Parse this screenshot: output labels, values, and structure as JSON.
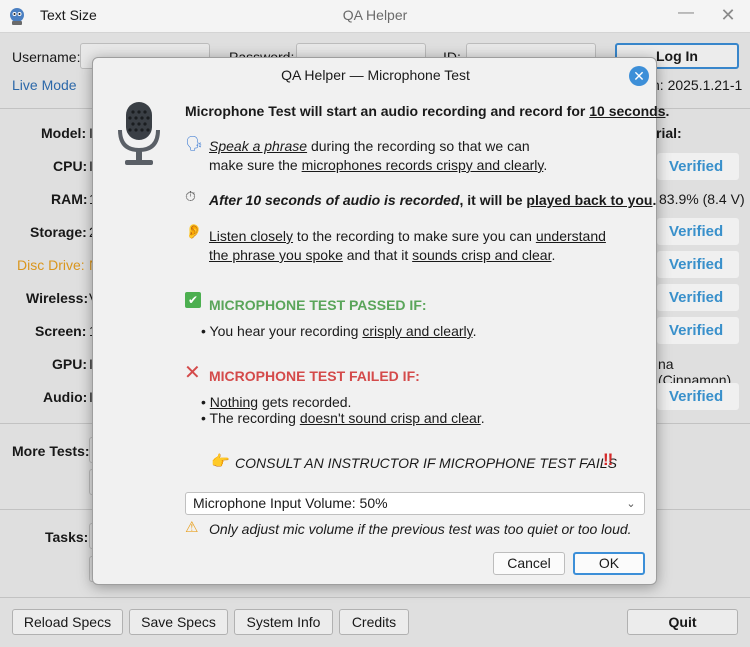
{
  "window": {
    "text_size_label": "Text Size",
    "title": "QA Helper",
    "minimize_glyph": "—",
    "close_glyph": "✕"
  },
  "login": {
    "username_label": "Username:",
    "password_label": "Password:",
    "id_label": "ID:",
    "login_button": "Log In",
    "live_mode": "Live Mode",
    "version_text": "n: 2025.1.21-1"
  },
  "specs": {
    "labels": [
      "Model:",
      "CPU:",
      "RAM:",
      "Storage:",
      "Disc Drive:",
      "Wireless:",
      "Screen:",
      "GPU:",
      "Audio:"
    ],
    "value_first_chars": [
      "I",
      "I",
      "1",
      "2",
      "N",
      "V",
      "1",
      "I",
      "I"
    ],
    "serial_label": "rial:",
    "ram_right_text": "83.9% (8.4 V)",
    "gpu_right_text": "na (Cinnamon)",
    "verified_label": "Verified"
  },
  "more_tests_label": "More Tests:",
  "tasks_label": "Tasks:",
  "bottom_buttons": {
    "reload": "Reload Specs",
    "save": "Save Specs",
    "system_info": "System Info",
    "credits": "Credits",
    "quit": "Quit"
  },
  "dialog": {
    "app_name": "QA Helper",
    "title_separator": "—",
    "title_name": "Microphone Test",
    "close_glyph": "✕",
    "icon": "microphone-icon",
    "intro": {
      "text": "Microphone Test will start an audio recording and record for ",
      "emphasis": "10 seconds",
      "end": "."
    },
    "speak": {
      "icon": "speaking-head-icon",
      "glyph": "🗣",
      "part1": "Speak a phrase",
      "part2": " during the recording so that we can",
      "part3": "make sure the ",
      "part4": "microphones records crispy and clearly",
      "part5": "."
    },
    "after": {
      "icon": "stopwatch-icon",
      "glyph": "⏱",
      "part1": "After 10 seconds of audio is recorded",
      "part2": ", it will be ",
      "part3": "played back to you",
      "part4": "."
    },
    "listen": {
      "icon": "ear-icon",
      "glyph": "👂",
      "part1": "Listen closely",
      "part2": " to the recording to make sure you can ",
      "part3": "understand",
      "part4": "the phrase you spoke",
      "part5": " and that it ",
      "part6": "sounds crisp and clear",
      "part7": "."
    },
    "passed": {
      "icon": "check-mark-icon",
      "glyph": "✔",
      "heading": "MICROPHONE TEST PASSED IF:",
      "bullet_glyph": "•",
      "b1a": " You hear your recording ",
      "b1b": "crisply and clearly",
      "b1c": "."
    },
    "failed": {
      "icon": "cross-mark-icon",
      "glyph": "✕",
      "heading": "MICROPHONE TEST FAILED IF:",
      "bullet_glyph": "•",
      "b1a": "Nothing",
      "b1b": " gets recorded.",
      "b2a": " The recording ",
      "b2b": "doesn't sound crisp and clear",
      "b2c": "."
    },
    "consult": {
      "icon": "pointing-hand-icon",
      "glyph": "👉",
      "text": "CONSULT AN INSTRUCTOR IF MICROPHONE TEST FAILS",
      "alert_glyph": "‼"
    },
    "volume_select": {
      "selected": "Microphone Input Volume: 50%",
      "chevron": "⌄"
    },
    "warning": {
      "icon": "warning-icon",
      "glyph": "⚠",
      "text": "Only adjust mic volume if the previous test was too quiet or too loud."
    },
    "cancel": "Cancel",
    "ok": "OK"
  }
}
